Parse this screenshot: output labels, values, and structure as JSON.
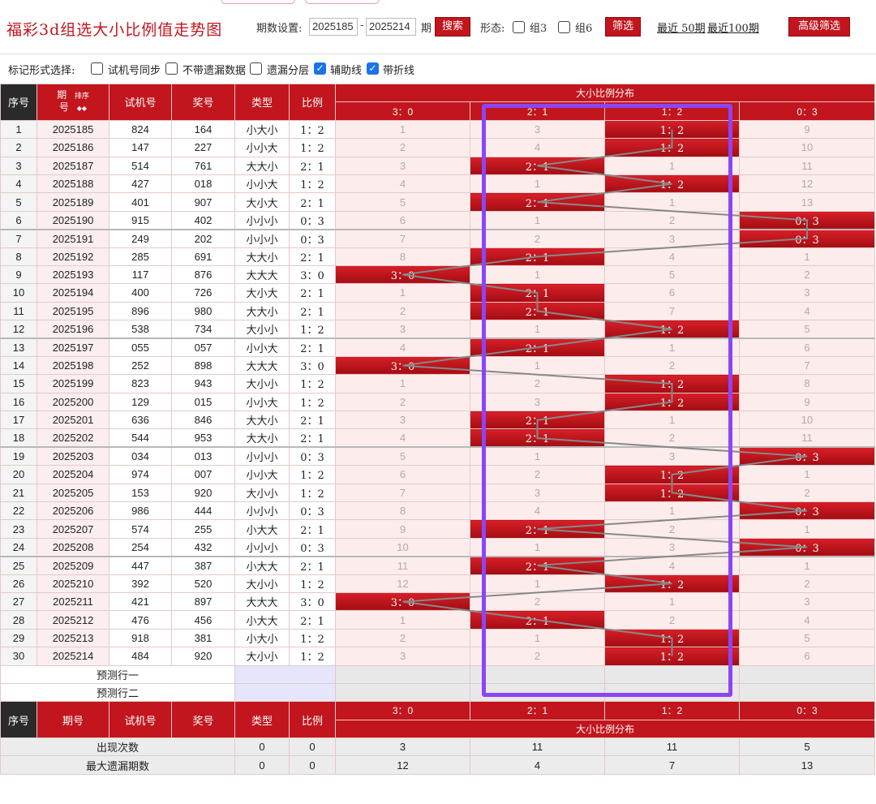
{
  "header": {
    "title": "福彩3d组选大小比例值走势图",
    "period_label": "期数设置:",
    "period_from": "2025185",
    "period_to": "2025214",
    "period_unit": "期",
    "search_btn": "搜索",
    "form_label": "形态:",
    "group3": "组3",
    "group6": "组6",
    "filter_btn": "筛选",
    "recent50": "最近 50期",
    "recent100": "最近100期",
    "adv_btn": "高级筛选"
  },
  "markbar": {
    "label": "标记形式选择:",
    "opt1": "试机号同步",
    "opt2": "不带遗漏数据",
    "opt3": "遗漏分层",
    "opt4": "辅助线",
    "opt5": "带折线",
    "opt1_checked": false,
    "opt2_checked": false,
    "opt3_checked": false,
    "opt4_checked": true,
    "opt5_checked": true
  },
  "table": {
    "h_seq": "序号",
    "h_issue_top": "期",
    "h_issue_bottom": "号",
    "h_sort": "排序",
    "h_trial": "试机号",
    "h_prize": "奖号",
    "h_type": "类型",
    "h_ratio": "比例",
    "h_dist": "大小比例分布",
    "ratios": [
      "3：0",
      "2：1",
      "1：2",
      "0：3"
    ],
    "rows": [
      {
        "seq": "1",
        "issue": "2025185",
        "trial": "824",
        "prize": "164",
        "type": "小大小",
        "ratio": "1：2",
        "cells": [
          "1",
          "3",
          "1：2",
          "9"
        ],
        "hit": 2
      },
      {
        "seq": "2",
        "issue": "2025186",
        "trial": "147",
        "prize": "227",
        "type": "小小大",
        "ratio": "1：2",
        "cells": [
          "2",
          "4",
          "1：2",
          "10"
        ],
        "hit": 2
      },
      {
        "seq": "3",
        "issue": "2025187",
        "trial": "514",
        "prize": "761",
        "type": "大大小",
        "ratio": "2：1",
        "cells": [
          "3",
          "2：1",
          "1",
          "11"
        ],
        "hit": 1
      },
      {
        "seq": "4",
        "issue": "2025188",
        "trial": "427",
        "prize": "018",
        "type": "小小大",
        "ratio": "1：2",
        "cells": [
          "4",
          "1",
          "1：2",
          "12"
        ],
        "hit": 2
      },
      {
        "seq": "5",
        "issue": "2025189",
        "trial": "401",
        "prize": "907",
        "type": "大小大",
        "ratio": "2：1",
        "cells": [
          "5",
          "2：1",
          "1",
          "13"
        ],
        "hit": 1
      },
      {
        "seq": "6",
        "issue": "2025190",
        "trial": "915",
        "prize": "402",
        "type": "小小小",
        "ratio": "0：3",
        "cells": [
          "6",
          "1",
          "2",
          "0：3"
        ],
        "hit": 3
      },
      {
        "seq": "7",
        "issue": "2025191",
        "trial": "249",
        "prize": "202",
        "type": "小小小",
        "ratio": "0：3",
        "cells": [
          "7",
          "2",
          "3",
          "0：3"
        ],
        "hit": 3
      },
      {
        "seq": "8",
        "issue": "2025192",
        "trial": "285",
        "prize": "691",
        "type": "大大小",
        "ratio": "2：1",
        "cells": [
          "8",
          "2：1",
          "4",
          "1"
        ],
        "hit": 1
      },
      {
        "seq": "9",
        "issue": "2025193",
        "trial": "117",
        "prize": "876",
        "type": "大大大",
        "ratio": "3：0",
        "cells": [
          "3：0",
          "1",
          "5",
          "2"
        ],
        "hit": 0
      },
      {
        "seq": "10",
        "issue": "2025194",
        "trial": "400",
        "prize": "726",
        "type": "大小大",
        "ratio": "2：1",
        "cells": [
          "1",
          "2：1",
          "6",
          "3"
        ],
        "hit": 1
      },
      {
        "seq": "11",
        "issue": "2025195",
        "trial": "896",
        "prize": "980",
        "type": "大大小",
        "ratio": "2：1",
        "cells": [
          "2",
          "2：1",
          "7",
          "4"
        ],
        "hit": 1
      },
      {
        "seq": "12",
        "issue": "2025196",
        "trial": "538",
        "prize": "734",
        "type": "大小小",
        "ratio": "1：2",
        "cells": [
          "3",
          "1",
          "1：2",
          "5"
        ],
        "hit": 2
      },
      {
        "seq": "13",
        "issue": "2025197",
        "trial": "055",
        "prize": "057",
        "type": "小小大",
        "ratio": "2：1",
        "cells": [
          "4",
          "2：1",
          "1",
          "6"
        ],
        "hit": 1
      },
      {
        "seq": "14",
        "issue": "2025198",
        "trial": "252",
        "prize": "898",
        "type": "大大大",
        "ratio": "3：0",
        "cells": [
          "3：0",
          "1",
          "2",
          "7"
        ],
        "hit": 0
      },
      {
        "seq": "15",
        "issue": "2025199",
        "trial": "823",
        "prize": "943",
        "type": "大小小",
        "ratio": "1：2",
        "cells": [
          "1",
          "2",
          "1：2",
          "8"
        ],
        "hit": 2
      },
      {
        "seq": "16",
        "issue": "2025200",
        "trial": "129",
        "prize": "015",
        "type": "小小大",
        "ratio": "1：2",
        "cells": [
          "2",
          "3",
          "1：2",
          "9"
        ],
        "hit": 2
      },
      {
        "seq": "17",
        "issue": "2025201",
        "trial": "636",
        "prize": "846",
        "type": "大大小",
        "ratio": "2：1",
        "cells": [
          "3",
          "2：1",
          "1",
          "10"
        ],
        "hit": 1
      },
      {
        "seq": "18",
        "issue": "2025202",
        "trial": "544",
        "prize": "953",
        "type": "大大小",
        "ratio": "2：1",
        "cells": [
          "4",
          "2：1",
          "2",
          "11"
        ],
        "hit": 1
      },
      {
        "seq": "19",
        "issue": "2025203",
        "trial": "034",
        "prize": "013",
        "type": "小小小",
        "ratio": "0：3",
        "cells": [
          "5",
          "1",
          "3",
          "0：3"
        ],
        "hit": 3
      },
      {
        "seq": "20",
        "issue": "2025204",
        "trial": "974",
        "prize": "007",
        "type": "小小大",
        "ratio": "1：2",
        "cells": [
          "6",
          "2",
          "1：2",
          "1"
        ],
        "hit": 2
      },
      {
        "seq": "21",
        "issue": "2025205",
        "trial": "153",
        "prize": "920",
        "type": "大小小",
        "ratio": "1：2",
        "cells": [
          "7",
          "3",
          "1：2",
          "2"
        ],
        "hit": 2
      },
      {
        "seq": "22",
        "issue": "2025206",
        "trial": "986",
        "prize": "444",
        "type": "小小小",
        "ratio": "0：3",
        "cells": [
          "8",
          "4",
          "1",
          "0：3"
        ],
        "hit": 3
      },
      {
        "seq": "23",
        "issue": "2025207",
        "trial": "574",
        "prize": "255",
        "type": "小大大",
        "ratio": "2：1",
        "cells": [
          "9",
          "2：1",
          "2",
          "1"
        ],
        "hit": 1
      },
      {
        "seq": "24",
        "issue": "2025208",
        "trial": "254",
        "prize": "432",
        "type": "小小小",
        "ratio": "0：3",
        "cells": [
          "10",
          "1",
          "3",
          "0：3"
        ],
        "hit": 3
      },
      {
        "seq": "25",
        "issue": "2025209",
        "trial": "447",
        "prize": "387",
        "type": "小大大",
        "ratio": "2：1",
        "cells": [
          "11",
          "2：1",
          "4",
          "1"
        ],
        "hit": 1
      },
      {
        "seq": "26",
        "issue": "2025210",
        "trial": "392",
        "prize": "520",
        "type": "大小小",
        "ratio": "1：2",
        "cells": [
          "12",
          "1",
          "1：2",
          "2"
        ],
        "hit": 2
      },
      {
        "seq": "27",
        "issue": "2025211",
        "trial": "421",
        "prize": "897",
        "type": "大大大",
        "ratio": "3：0",
        "cells": [
          "3：0",
          "2",
          "1",
          "3"
        ],
        "hit": 0
      },
      {
        "seq": "28",
        "issue": "2025212",
        "trial": "476",
        "prize": "456",
        "type": "小大大",
        "ratio": "2：1",
        "cells": [
          "1",
          "2：1",
          "2",
          "4"
        ],
        "hit": 1
      },
      {
        "seq": "29",
        "issue": "2025213",
        "trial": "918",
        "prize": "381",
        "type": "小大小",
        "ratio": "1：2",
        "cells": [
          "2",
          "1",
          "1：2",
          "5"
        ],
        "hit": 2
      },
      {
        "seq": "30",
        "issue": "2025214",
        "trial": "484",
        "prize": "920",
        "type": "大小小",
        "ratio": "1：2",
        "cells": [
          "3",
          "2",
          "1：2",
          "6"
        ],
        "hit": 2
      }
    ],
    "predict1": "预测行一",
    "predict2": "预测行二",
    "stats": [
      {
        "label": "出现次数",
        "type": "0",
        "ratio": "0",
        "cells": [
          "3",
          "11",
          "11",
          "5"
        ]
      },
      {
        "label": "最大遗漏期数",
        "type": "0",
        "ratio": "0",
        "cells": [
          "12",
          "4",
          "7",
          "13"
        ]
      }
    ]
  },
  "colors": {
    "accent": "#c2151d",
    "highlight_box": "#8b45f5"
  }
}
